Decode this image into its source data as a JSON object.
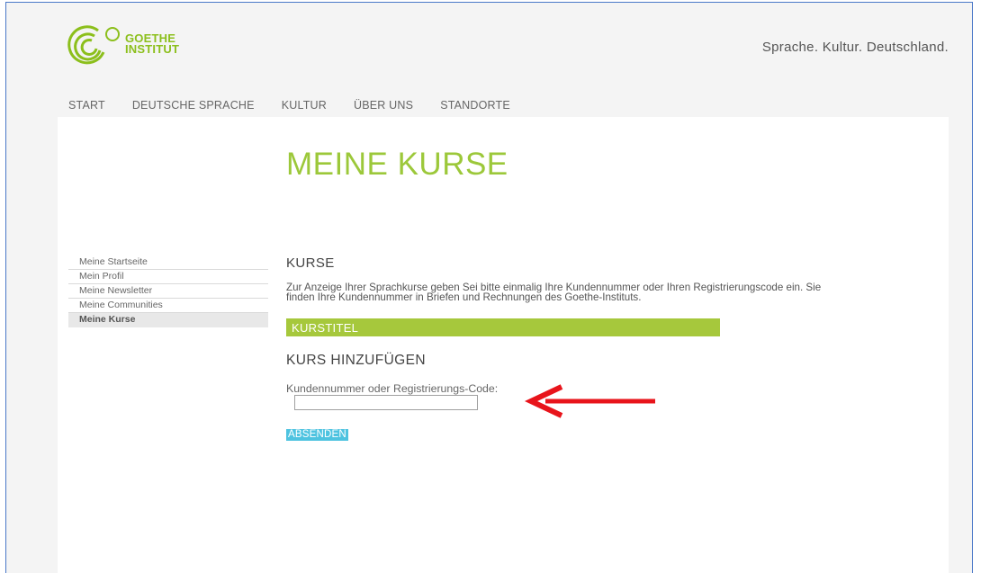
{
  "brand": {
    "logo_line1": "GOETHE",
    "logo_line2": "INSTITUT",
    "tagline": "Sprache. Kultur. Deutschland.",
    "color": "#8cbf1c"
  },
  "topnav": [
    "START",
    "DEUTSCHE SPRACHE",
    "KULTUR",
    "ÜBER UNS",
    "STANDORTE"
  ],
  "page_title": "MEINE KURSE",
  "sidebar": {
    "items": [
      {
        "label": "Meine Startseite",
        "active": false
      },
      {
        "label": "Mein Profil",
        "active": false
      },
      {
        "label": "Meine Newsletter",
        "active": false
      },
      {
        "label": "Meine Communities",
        "active": false
      },
      {
        "label": "Meine Kurse",
        "active": true
      }
    ]
  },
  "main": {
    "section_title": "KURSE",
    "intro_line1": "Zur Anzeige Ihrer Sprachkurse geben Sei bitte einmalig Ihre Kundennummer oder Ihren Registrierungscode ein. Sie",
    "intro_line2": "finden Ihre Kundennummer in Briefen und Rechnungen des Goethe-Instituts.",
    "kurstitel": "KURSTITEL",
    "add_title": "KURS HINZUFÜGEN",
    "field_label": "Kundennummer oder Registrierungs-Code:",
    "field_value": "",
    "submit_label": "ABSENDEN"
  },
  "annotation": {
    "icon": "red-arrow-icon",
    "color": "#e8141b"
  },
  "colors": {
    "accent_green": "#9cc83a",
    "button_blue": "#4ec3e0"
  }
}
